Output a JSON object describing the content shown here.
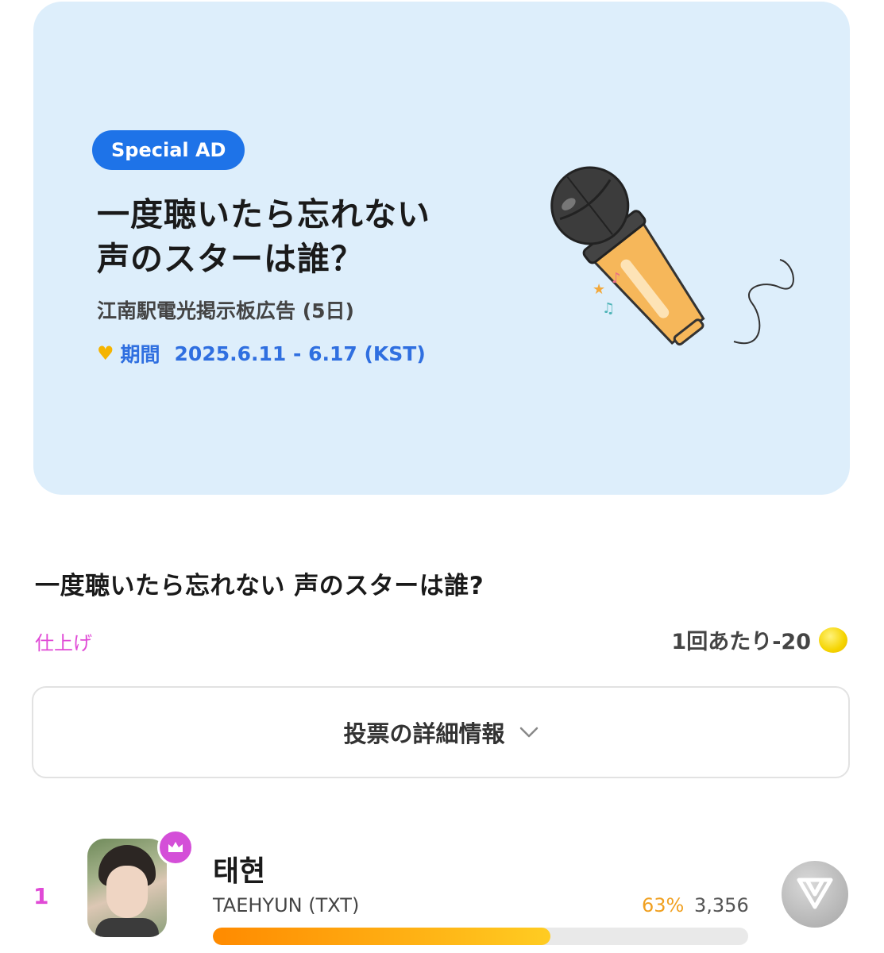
{
  "banner": {
    "badge": "Special AD",
    "title_line1": "一度聴いたら忘れない",
    "title_line2": "声のスターは誰？",
    "subtitle": "江南駅電光掲示板広告 (5日)",
    "period_label": "期間",
    "period_dates": "2025.6.11 - 6.17 (KST)"
  },
  "vote": {
    "title": "一度聴いたら忘れない 声のスターは誰?",
    "status": "仕上げ",
    "cost": "1回あたり-20",
    "details_label": "投票の詳細情報"
  },
  "candidates": [
    {
      "rank": "1",
      "name": "태현",
      "group": "TAEHYUN (TXT)",
      "percent_text": "63%",
      "percent": 63,
      "votes": "3,356"
    }
  ],
  "colors": {
    "accent_pink": "#e04ad6",
    "accent_blue": "#1e73e8",
    "progress_orange": "#ff8a00",
    "banner_bg": "#ddeefb"
  },
  "icons": [
    "heart-icon",
    "microphone-illustration",
    "coin-icon",
    "chevron-down-icon",
    "crown-icon",
    "vote-icon"
  ]
}
